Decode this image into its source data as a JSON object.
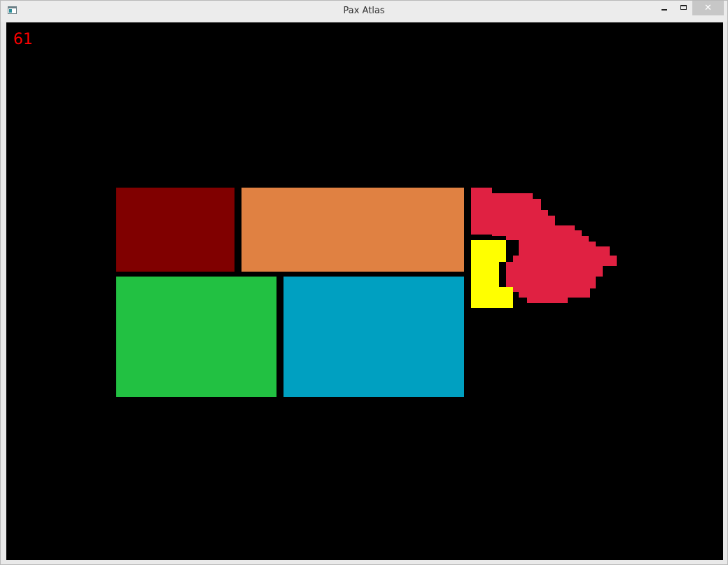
{
  "window": {
    "title": "Pax Atlas",
    "close_glyph": "✕"
  },
  "hud": {
    "fps": "61"
  },
  "colors": {
    "background": "#000000",
    "dark_red": "#800000",
    "orange": "#e08142",
    "green": "#22c142",
    "cyan": "#00a0c1",
    "yellow": "#ffff00",
    "crimson": "#e02142",
    "hud_text": "#ff0000"
  },
  "icons": {
    "app": "app-window-icon",
    "minimize": "minimize-icon",
    "maximize": "maximize-icon",
    "close": "close-icon"
  }
}
